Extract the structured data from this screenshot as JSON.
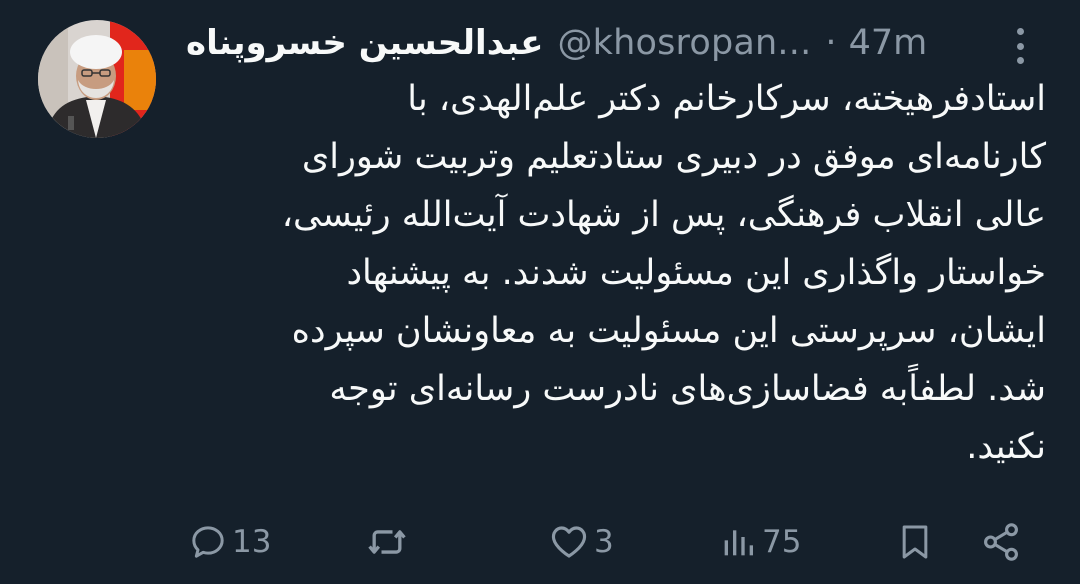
{
  "tweet": {
    "author": {
      "display_name": "عبدالحسین خسروپناه",
      "handle": "@khosropan...",
      "avatar_icon": "profile-photo"
    },
    "separator": "·",
    "time": "47m",
    "body_lines": [
      "استادفرهیخته، سرکارخانم دکتر علم‌الهدی، با",
      "کارنامه‌ای موفق در دبیری ستادتعلیم وتربیت شورای",
      "عالی انقلاب فرهنگی، پس از شهادت آیت‌الله رئیسی،",
      "خواستار واگذاری این مسئولیت شدند. به پیشنهاد",
      "ایشان، سرپرستی این مسئولیت به معاونشان سپرده",
      "شد. لطفاًبه فضاسازی‌های نادرست رسانه‌ای توجه",
      "نکنید."
    ],
    "actions": {
      "reply_count": "13",
      "retweet_count": "",
      "like_count": "3",
      "views_count": "75"
    }
  },
  "colors": {
    "background": "#15202b",
    "text": "#f7f9f9",
    "secondary": "#8b98a5"
  }
}
